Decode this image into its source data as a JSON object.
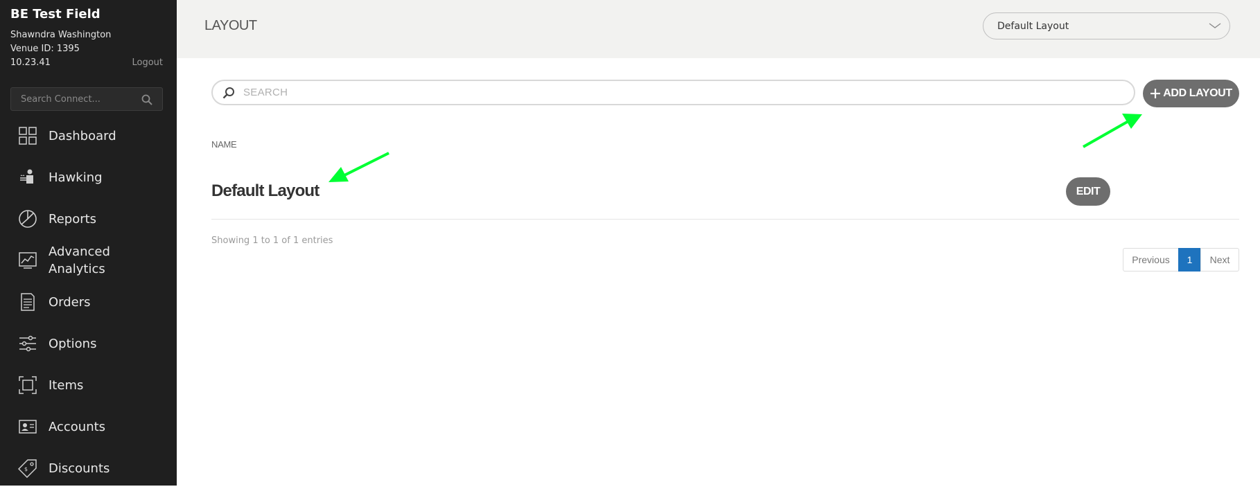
{
  "sidebar": {
    "venue_name": "BE Test Field",
    "user_name": "Shawndra Washington",
    "venue_id": "Venue ID: 1395",
    "version": "10.23.41",
    "logout_label": "Logout",
    "search_placeholder": "Search Connect...",
    "items": [
      {
        "label": "Dashboard",
        "icon": "dashboard-icon"
      },
      {
        "label": "Hawking",
        "icon": "hawking-icon"
      },
      {
        "label": "Reports",
        "icon": "reports-icon"
      },
      {
        "label": "Advanced Analytics",
        "icon": "analytics-icon"
      },
      {
        "label": "Orders",
        "icon": "orders-icon"
      },
      {
        "label": "Options",
        "icon": "options-icon"
      },
      {
        "label": "Items",
        "icon": "items-icon"
      },
      {
        "label": "Accounts",
        "icon": "accounts-icon"
      },
      {
        "label": "Discounts",
        "icon": "discounts-icon"
      }
    ]
  },
  "header": {
    "title": "LAYOUT",
    "layout_select_value": "Default Layout"
  },
  "main": {
    "search_placeholder": "SEARCH",
    "add_button_label": "ADD LAYOUT",
    "column_header": "NAME",
    "rows": [
      {
        "name": "Default Layout",
        "action_label": "EDIT"
      }
    ],
    "entries_info": "Showing 1 to 1 of 1 entries",
    "pagination": {
      "previous_label": "Previous",
      "current_page": "1",
      "next_label": "Next"
    }
  },
  "colors": {
    "sidebar_bg": "#1f1f1f",
    "header_bg": "#f2f2f0",
    "button_bg": "#6e6e6e",
    "pagination_active": "#1e73be",
    "annotation_arrow": "#00ff33"
  }
}
